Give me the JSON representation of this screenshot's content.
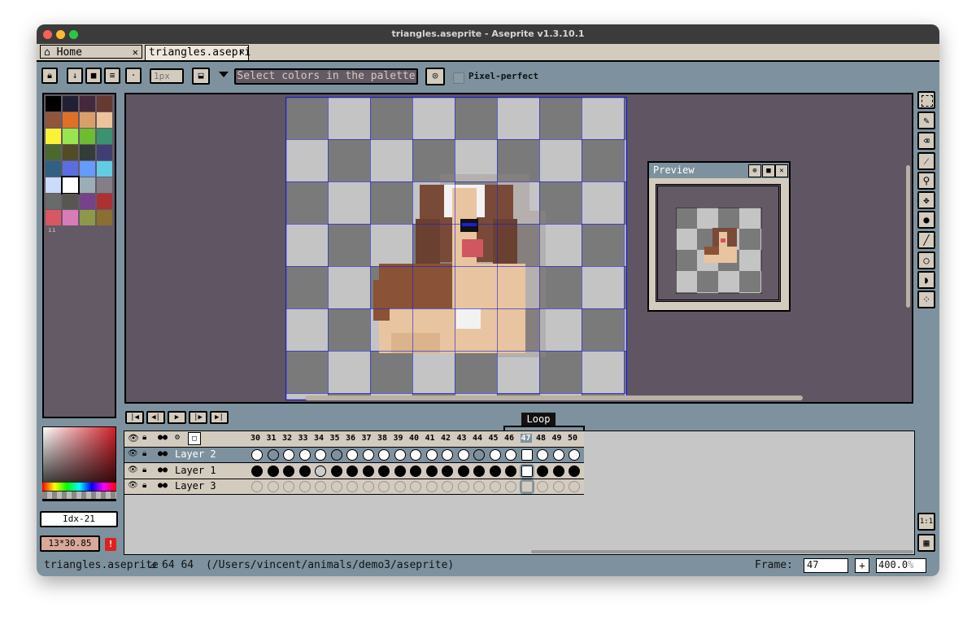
{
  "window": {
    "title": "triangles.aseprite - Aseprite v1.3.10.1",
    "traffic_colors": [
      "#fe5f57",
      "#febc2e",
      "#28c840"
    ]
  },
  "tabs": [
    {
      "label": "Home",
      "icon": "home-icon",
      "close": "✕"
    },
    {
      "label": "triangles.asepri",
      "close": "✕"
    }
  ],
  "toolbar": {
    "brush_size": "1px",
    "hint_text": "Select colors in the palette",
    "pixel_perfect_label": "Pixel-perfect"
  },
  "palette": {
    "colors": [
      "#000000",
      "#222034",
      "#45283c",
      "#663931",
      "#8f563b",
      "#df7126",
      "#d9a066",
      "#eec39a",
      "#fbf236",
      "#99e550",
      "#6abe30",
      "#37946e",
      "#4b692f",
      "#524b24",
      "#323c39",
      "#3f3f74",
      "#306082",
      "#5b6ee1",
      "#639bff",
      "#5fcde4",
      "#cbdbfc",
      "#ffffff",
      "#9badb7",
      "#847e87",
      "#696a6a",
      "#595652",
      "#76428a",
      "#ac3232",
      "#d95763",
      "#d77bba",
      "#8f974a",
      "#8a6f30"
    ]
  },
  "color_panel": {
    "index_label": "Idx-21",
    "coords_label": "13*30.85",
    "alert_icon": "!"
  },
  "preview": {
    "title": "Preview"
  },
  "timeline": {
    "loop_label": "Loop",
    "frames": [
      "30",
      "31",
      "32",
      "33",
      "34",
      "35",
      "36",
      "37",
      "38",
      "39",
      "40",
      "41",
      "42",
      "43",
      "44",
      "45",
      "46",
      "47",
      "48",
      "49",
      "50"
    ],
    "current_frame": "47",
    "layers": [
      {
        "name": "Layer 2",
        "selected": true
      },
      {
        "name": "Layer 1",
        "selected": false
      },
      {
        "name": "Layer 3",
        "selected": false
      }
    ]
  },
  "status": {
    "filename": "triangles.aseprite",
    "size": "64 64",
    "path": "(/Users/vincent/animals/demo3/aseprite)",
    "frame_label": "Frame:",
    "frame_value": "47",
    "zoom": "400.0",
    "zoom_unit": "%",
    "ratio_label": "1:1"
  }
}
